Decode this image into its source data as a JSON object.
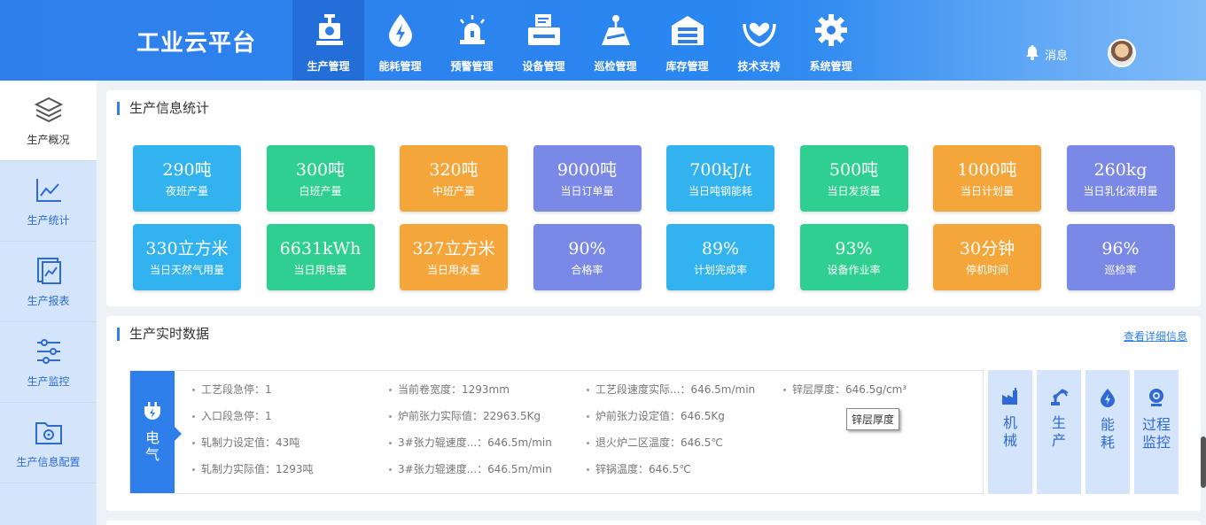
{
  "app": {
    "title": "工业云平台"
  },
  "nav": [
    {
      "label": "生产管理",
      "icon": "production-machine-icon",
      "active": true
    },
    {
      "label": "能耗管理",
      "icon": "energy-drop-icon"
    },
    {
      "label": "预警管理",
      "icon": "alarm-siren-icon"
    },
    {
      "label": "设备管理",
      "icon": "device-printer-icon"
    },
    {
      "label": "巡检管理",
      "icon": "inspection-road-icon"
    },
    {
      "label": "库存管理",
      "icon": "warehouse-icon"
    },
    {
      "label": "技术支持",
      "icon": "support-heart-icon"
    },
    {
      "label": "系统管理",
      "icon": "gear-icon"
    }
  ],
  "header": {
    "message_label": "消息"
  },
  "sidebar": [
    {
      "label": "生产概况",
      "icon": "layers-icon",
      "active": true
    },
    {
      "label": "生产统计",
      "icon": "line-chart-icon"
    },
    {
      "label": "生产报表",
      "icon": "report-icon"
    },
    {
      "label": "生产监控",
      "icon": "sliders-icon"
    },
    {
      "label": "生产信息配置",
      "icon": "folder-settings-icon"
    }
  ],
  "stats_panel": {
    "title": "生产信息统计",
    "items": [
      {
        "value": "290吨",
        "label": "夜班产量",
        "color": "#32b3ef"
      },
      {
        "value": "300吨",
        "label": "白班产量",
        "color": "#2ecf90"
      },
      {
        "value": "320吨",
        "label": "中班产量",
        "color": "#f5a63b"
      },
      {
        "value": "9000吨",
        "label": "当日订单量",
        "color": "#7b89e6"
      },
      {
        "value": "700kJ/t",
        "label": "当日吨钢能耗",
        "color": "#32b3ef"
      },
      {
        "value": "500吨",
        "label": "当日发货量",
        "color": "#2ecf90"
      },
      {
        "value": "1000吨",
        "label": "当日计划量",
        "color": "#f5a63b"
      },
      {
        "value": "260kg",
        "label": "当日乳化液用量",
        "color": "#7b89e6"
      },
      {
        "value": "330立方米",
        "label": "当日天然气用量",
        "color": "#32b3ef"
      },
      {
        "value": "6631kWh",
        "label": "当日用电量",
        "color": "#2ecf90"
      },
      {
        "value": "327立方米",
        "label": "当日用水量",
        "color": "#f5a63b"
      },
      {
        "value": "90%",
        "label": "合格率",
        "color": "#7b89e6"
      },
      {
        "value": "89%",
        "label": "计划完成率",
        "color": "#32b3ef"
      },
      {
        "value": "93%",
        "label": "设备作业率",
        "color": "#2ecf90"
      },
      {
        "value": "30分钟",
        "label": "停机时间",
        "color": "#f5a63b"
      },
      {
        "value": "96%",
        "label": "巡检率",
        "color": "#7b89e6"
      }
    ]
  },
  "realtime_panel": {
    "title": "生产实时数据",
    "detail_link": "查看详细信息",
    "active_tab": "电气",
    "cells": [
      "工艺段急停：1",
      "当前卷宽度：1293mm",
      "工艺段速度实际...：646.5m/min",
      "锌层厚度：646.5g/cm³",
      "入口段急停：1",
      "炉前张力实际值：22963.5Kg",
      "炉前张力设定值：646.5Kg",
      "",
      "轧制力设定值：43吨",
      "3#张力辊速度...：646.5m/min",
      "退火炉二区温度：646.5℃",
      "",
      "轧制力实际值：1293吨",
      "3#张力辊速度...：646.5m/min",
      "锌锅温度：646.5℃",
      ""
    ],
    "tooltip": "锌层厚度",
    "side_tabs": [
      {
        "label": "机\n械",
        "icon": "machine-icon"
      },
      {
        "label": "生\n产",
        "icon": "robot-arm-icon"
      },
      {
        "label": "能\n耗",
        "icon": "energy-drop-icon"
      },
      {
        "label": "过程\n监控",
        "icon": "camera-icon"
      }
    ]
  }
}
